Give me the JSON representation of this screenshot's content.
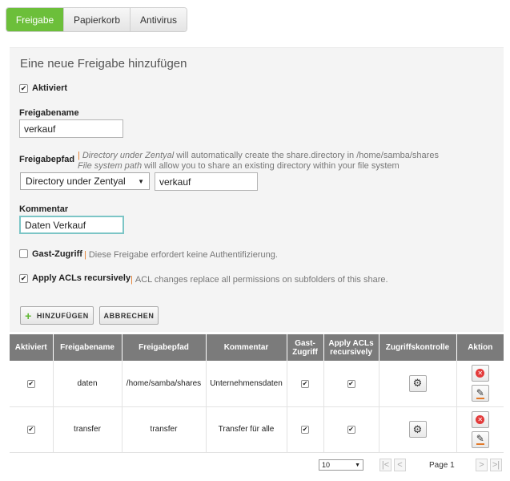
{
  "tabs": [
    {
      "label": "Freigabe",
      "active": true
    },
    {
      "label": "Papierkorb",
      "active": false
    },
    {
      "label": "Antivirus",
      "active": false
    }
  ],
  "form": {
    "title": "Eine neue Freigabe hinzufügen",
    "enabled": {
      "label": "Aktiviert",
      "checked": true
    },
    "share_name": {
      "label": "Freigabename",
      "value": "verkauf"
    },
    "share_path": {
      "label": "Freigabepfad",
      "help_line1_em": "Directory under Zentyal",
      "help_line1_rest": " will automatically create the share.directory in /home/samba/shares",
      "help_line2_em": "File system path",
      "help_line2_rest": " will allow you to share an existing directory within your file system",
      "select_value": "Directory under Zentyal",
      "path_value": "verkauf"
    },
    "comment": {
      "label": "Kommentar",
      "value": "Daten Verkauf"
    },
    "guest": {
      "label": "Gast-Zugriff",
      "checked": false,
      "help": "Diese Freigabe erfordert keine Authentifizierung."
    },
    "acls": {
      "label": "Apply ACLs recursively",
      "checked": true,
      "help": "ACL changes replace all permissions on subfolders of this share."
    },
    "add_button": "HINZUFÜGEN",
    "cancel_button": "ABBRECHEN"
  },
  "table": {
    "headers": [
      "Aktiviert",
      "Freigabename",
      "Freigabepfad",
      "Kommentar",
      "Gast-Zugriff",
      "Apply ACLs recursively",
      "Zugriffskontrolle",
      "Aktion"
    ],
    "rows": [
      {
        "enabled": true,
        "name": "daten",
        "path": "/home/samba/shares",
        "comment": "Unternehmensdaten",
        "guest": true,
        "acls": true
      },
      {
        "enabled": true,
        "name": "transfer",
        "path": "transfer",
        "comment": "Transfer für alle",
        "guest": true,
        "acls": true
      }
    ]
  },
  "pagination": {
    "page_size": "10",
    "page_label": "Page 1"
  },
  "icons": {
    "plus": "plus-icon",
    "gear": "gear-icon",
    "delete": "delete-icon",
    "edit": "pencil-icon"
  },
  "colors": {
    "accent_green": "#6cbf3a",
    "table_header": "#7b7b7b",
    "help_pipe": "#e37928",
    "delete_red": "#e33a3a"
  }
}
